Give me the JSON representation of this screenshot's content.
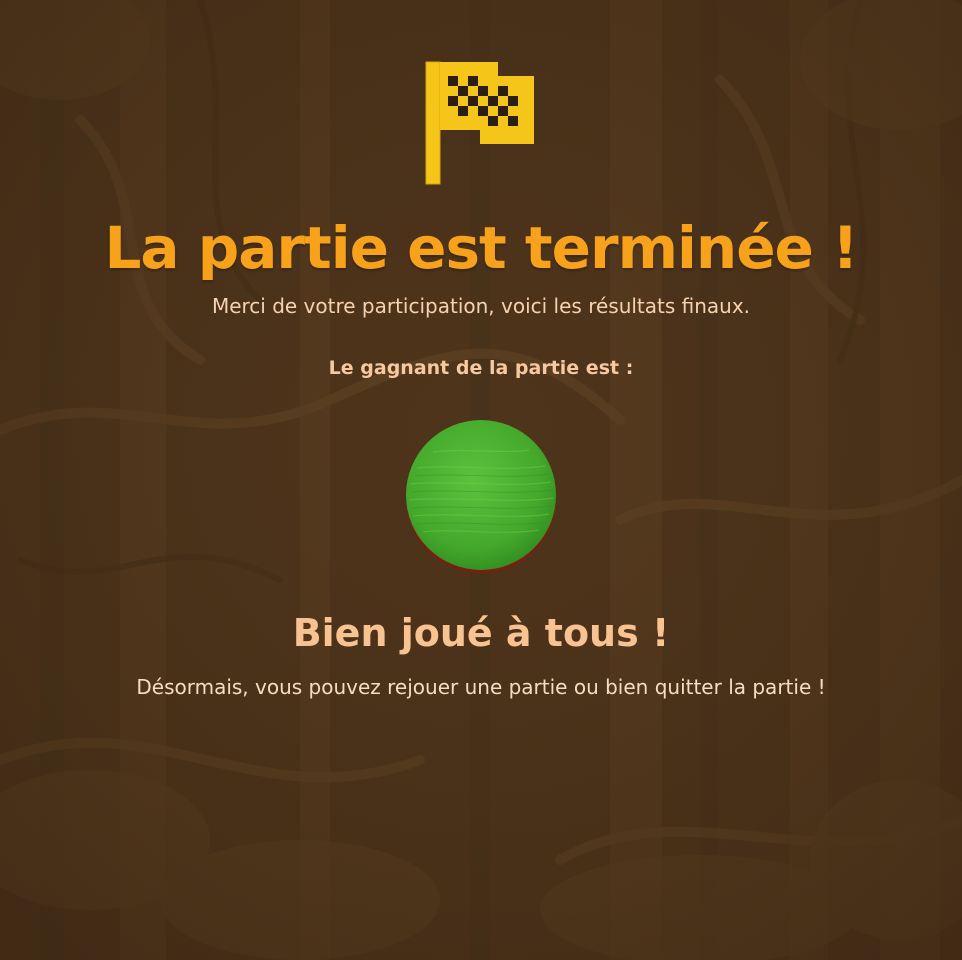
{
  "colors": {
    "background": "#4a3119",
    "title": "#f7a21a",
    "subtitle": "#f7d2b0",
    "winner_label": "#f7c9a0",
    "well_played": "#f9c291",
    "flag": "#f6c51a",
    "winner_token": "#4bb532"
  },
  "header": {
    "icon": "checkered-flag-icon",
    "title": "La partie est terminée !",
    "subtitle": "Merci de votre participation, voici les résultats finaux."
  },
  "winner": {
    "label": "Le gagnant de la partie est :",
    "token_icon": "green-player-token",
    "token_color": "green"
  },
  "footer": {
    "headline": "Bien joué à tous !",
    "message": "Désormais, vous pouvez rejouer une partie ou bien quitter la partie !"
  }
}
